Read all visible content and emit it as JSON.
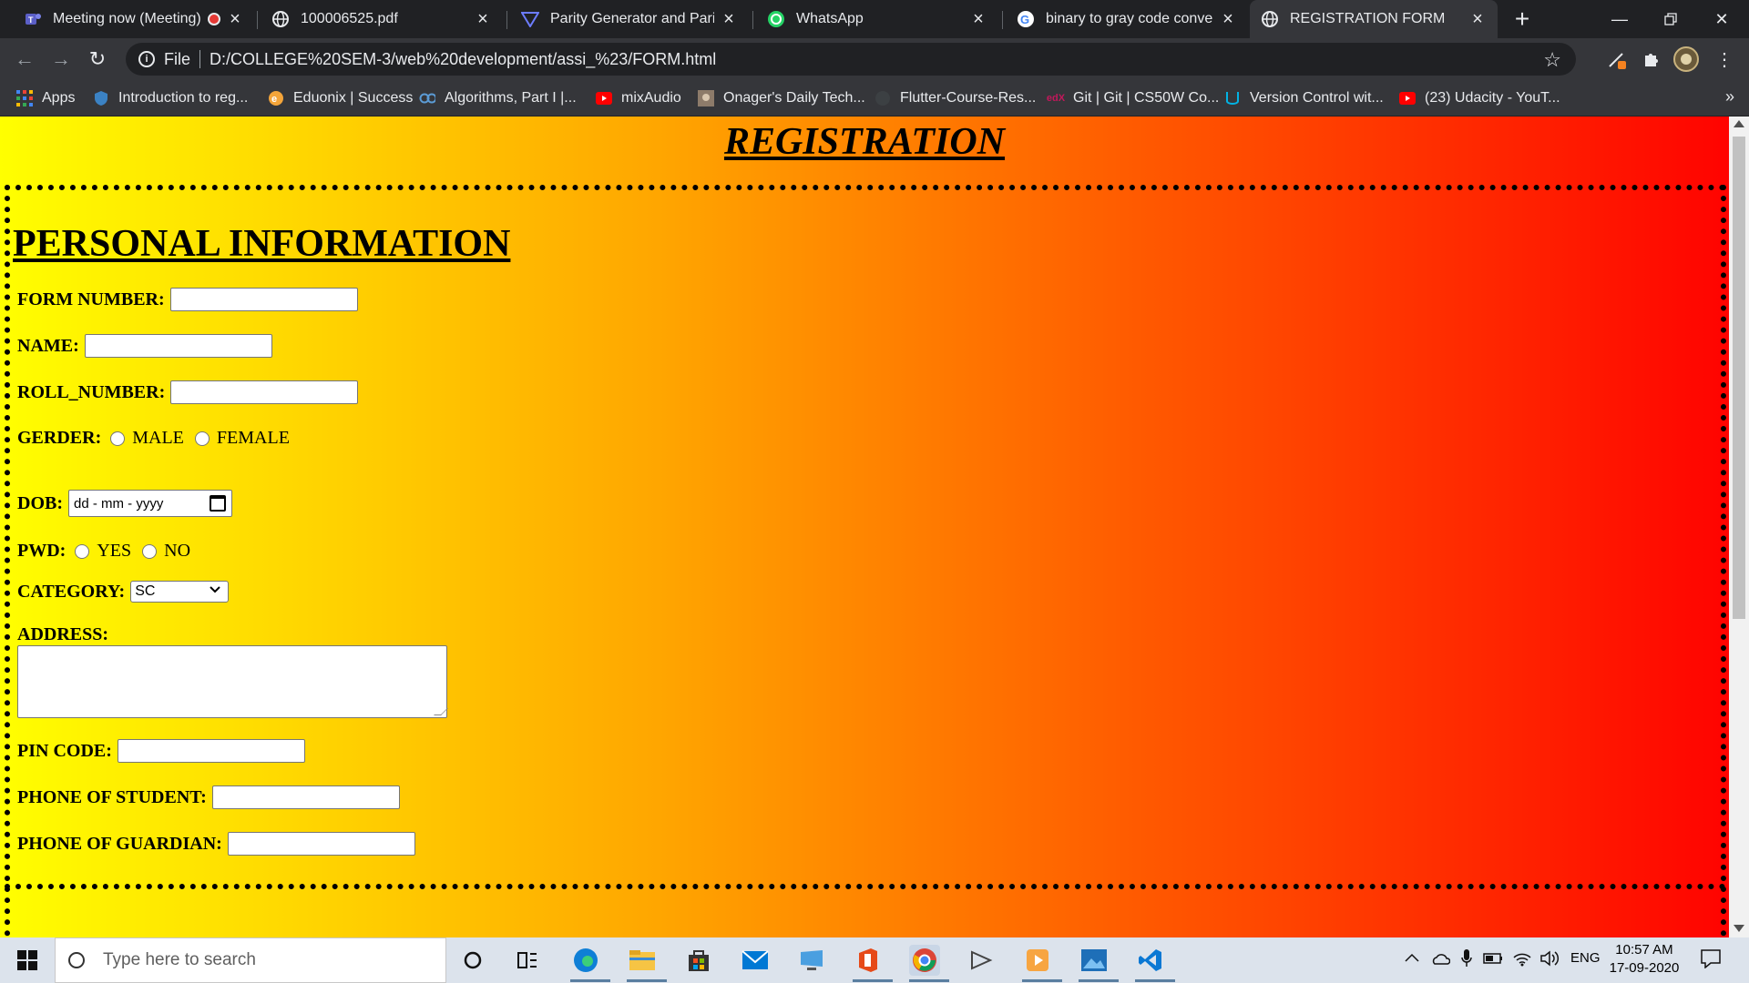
{
  "tabs": [
    {
      "title": "Meeting now (Meeting) |",
      "icon": "teams-icon",
      "active": false
    },
    {
      "title": "100006525.pdf",
      "icon": "globe-icon",
      "active": false
    },
    {
      "title": "Parity Generator and Parity C",
      "icon": "triangle-logo-icon",
      "active": false
    },
    {
      "title": "WhatsApp",
      "icon": "whatsapp-icon",
      "active": false
    },
    {
      "title": "binary to gray code converte",
      "icon": "google-icon",
      "active": false
    },
    {
      "title": "REGISTRATION FORM",
      "icon": "globe-icon",
      "active": true
    }
  ],
  "toolbar": {
    "file_label": "File",
    "url": "D:/COLLEGE%20SEM-3/web%20development/assi_%23/FORM.html"
  },
  "bookmarks": [
    {
      "label": "Apps",
      "icon": "apps-grid-icon"
    },
    {
      "label": "Introduction to reg...",
      "icon": "shield-icon"
    },
    {
      "label": "Eduonix | Success",
      "icon": "eduonix-icon"
    },
    {
      "label": "Algorithms, Part I |...",
      "icon": "coursera-icon"
    },
    {
      "label": "mixAudio",
      "icon": "youtube-icon"
    },
    {
      "label": "Onager's Daily Tech...",
      "icon": "image-thumb-icon"
    },
    {
      "label": "Flutter-Course-Res...",
      "icon": "github-icon"
    },
    {
      "label": "Git | Git | CS50W Co...",
      "icon": "edx-icon"
    },
    {
      "label": "Version Control wit...",
      "icon": "udacity-icon"
    },
    {
      "label": "(23) Udacity - YouT...",
      "icon": "youtube-icon"
    }
  ],
  "page": {
    "heading": "REGISTRATION",
    "section_title": "PERSONAL INFORMATION",
    "fields": {
      "form_number": "FORM NUMBER:",
      "name": "NAME:",
      "roll_number": "ROLL_NUMBER:",
      "gender": "GERDER:",
      "gender_male": "MALE",
      "gender_female": "FEMALE",
      "dob": "DOB:",
      "dob_placeholder": "dd - mm - yyyy",
      "pwd": "PWD:",
      "pwd_yes": "YES",
      "pwd_no": "NO",
      "category": "CATEGORY:",
      "category_selected": "SC",
      "address": "ADDRESS:",
      "pin_code": "PIN CODE:",
      "phone_student": "PHONE OF STUDENT:",
      "phone_guardian": "PHONE OF GUARDIAN:"
    }
  },
  "taskbar": {
    "search_placeholder": "Type here to search",
    "language": "ENG",
    "time": "10:57 AM",
    "date": "17-09-2020"
  },
  "colors": {
    "gradient_start": "#ffff00",
    "gradient_end": "#ff0000"
  }
}
